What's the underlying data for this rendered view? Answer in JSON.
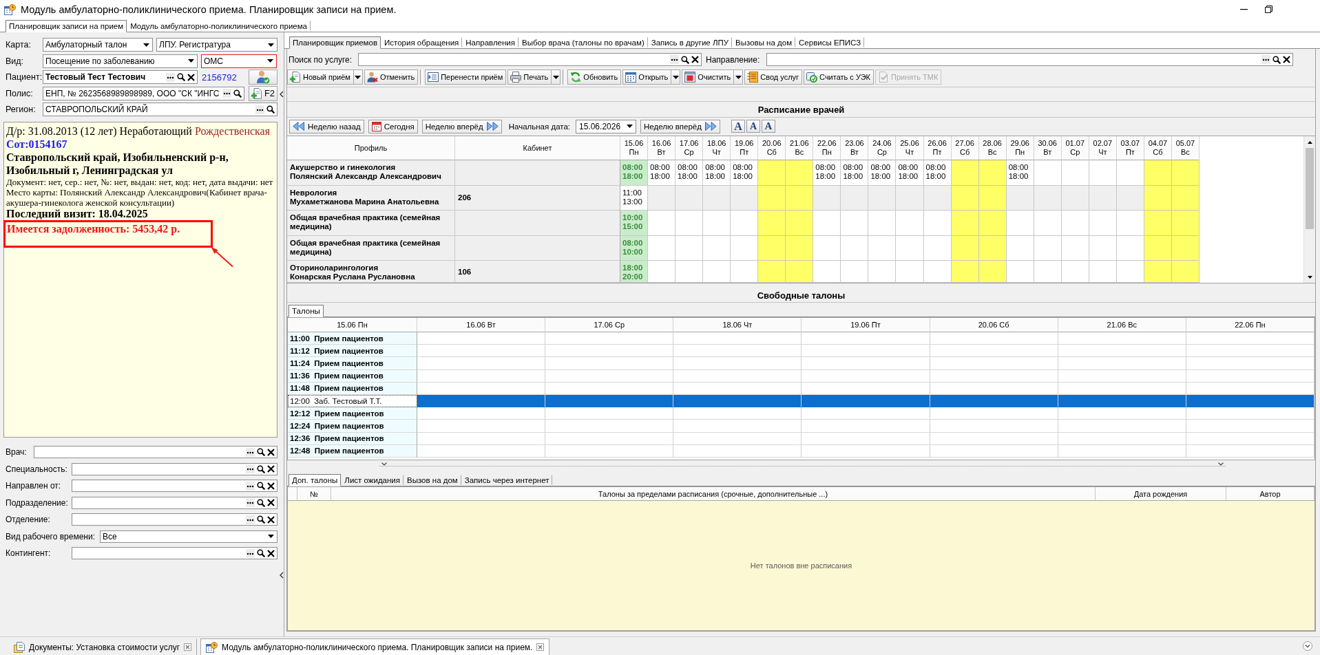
{
  "window": {
    "title": "Модуль амбулаторно-поликлинического приема. Планировщик записи на прием."
  },
  "module_tabs": [
    {
      "label": "Планировщик записи на прием",
      "selected": true
    },
    {
      "label": "Модуль амбулаторно-поликлинического приема",
      "selected": false
    }
  ],
  "patient_form": {
    "card": {
      "label": "Карта:",
      "type": "Амбулаторный талон",
      "registry": "ЛПУ. Регистратура"
    },
    "visit": {
      "label": "Вид:",
      "type": "Посещение по заболеванию",
      "payment": "ОМС",
      "payment_error": true
    },
    "patient": {
      "label": "Пациент:",
      "name": "Тестовый Тест Тестович",
      "number": "2156792"
    },
    "policy": {
      "label": "Полис:",
      "value": "ЕНП, № 2623568989898989, ООО \"СК \"ИНГС",
      "button": "F2"
    },
    "region": {
      "label": "Регион:",
      "value": "СТАВРОПОЛЬСКИЙ КРАЙ"
    }
  },
  "info": {
    "birth": "Д/р: 31.08.2013 (12 лет) Неработающий",
    "surname": "Рождественская",
    "code": "Сот:0154167",
    "address": "Ставропольский край, Изобильненский р-н, Изобильный г, Ленинградская ул",
    "document": "Документ: нет, сер.: нет, №: нет, выдан: нет, код: нет, дата выдачи: нет",
    "card_place": "Место карты: Полянский Александр Александрович(Кабинет врача-акушера-гинеколога женской консультации)",
    "last_visit": "Последний визит: 18.04.2025",
    "debt": "Имеется задолженность: 5453,42 р.",
    "debt_marked": true
  },
  "filters": [
    {
      "label": "Врач:",
      "kind": "primary"
    },
    {
      "label": "Специальность:",
      "kind": "lookup"
    },
    {
      "label": "Направлен от:",
      "kind": "lookup"
    },
    {
      "label": "Подразделение:",
      "kind": "lookup"
    },
    {
      "label": "Отделение:",
      "kind": "lookup"
    },
    {
      "label": "Вид рабочего времени:",
      "kind": "select",
      "value": "Все"
    },
    {
      "label": "Контингент:",
      "kind": "lookup"
    }
  ],
  "tabs": [
    {
      "label": "Планировщик приемов",
      "selected": true
    },
    {
      "label": "История обращения",
      "selected": false
    },
    {
      "label": "Направления",
      "selected": false
    },
    {
      "label": "Выбор врача (талоны по врачам)",
      "selected": false
    },
    {
      "label": "Запись в другие ЛПУ",
      "selected": false
    },
    {
      "label": "Вызовы на дом",
      "selected": false
    },
    {
      "label": "Сервисы ЕПИСЗ",
      "selected": false
    }
  ],
  "search": {
    "service_label": "Поиск по услуге:",
    "direction_label": "Направление:"
  },
  "toolbar": [
    {
      "buttons": [
        {
          "label": "Новый приём",
          "dropdown": true,
          "disabled": false
        },
        {
          "label": "Отменить",
          "dropdown": false,
          "disabled": false
        }
      ]
    },
    {
      "buttons": [
        {
          "label": "Перенести приём",
          "dropdown": false,
          "disabled": false
        },
        {
          "label": "Печать",
          "dropdown": true,
          "disabled": false
        }
      ]
    },
    {
      "buttons": [
        {
          "label": "Обновить",
          "dropdown": false,
          "disabled": false
        },
        {
          "label": "Открыть",
          "dropdown": true,
          "disabled": false
        },
        {
          "label": "Очистить",
          "dropdown": true,
          "disabled": false
        },
        {
          "label": "Свод услуг",
          "dropdown": false,
          "disabled": false
        },
        {
          "label": "Считать с УЭК",
          "dropdown": false,
          "disabled": false
        },
        {
          "label": "Принять ТМК",
          "dropdown": false,
          "disabled": true
        }
      ]
    }
  ],
  "schedule": {
    "title": "Расписание врачей",
    "nav": {
      "back": "Неделю назад",
      "today": "Сегодня",
      "forward": "Неделю вперёд",
      "date_label": "Начальная дата:",
      "date": "15.06.2026",
      "forward_again": "Неделю вперёд",
      "font_buttons": [
        "A",
        "A",
        "A"
      ]
    },
    "profile_header": "Профиль",
    "cabinet_header": "Кабинет",
    "days": [
      {
        "date": "15.06",
        "weekday": "Пн"
      },
      {
        "date": "16.06",
        "weekday": "Вт"
      },
      {
        "date": "17.06",
        "weekday": "Ср"
      },
      {
        "date": "18.06",
        "weekday": "Чт"
      },
      {
        "date": "19.06",
        "weekday": "Пт"
      },
      {
        "date": "20.06",
        "weekday": "Сб"
      },
      {
        "date": "21.06",
        "weekday": "Вс"
      },
      {
        "date": "22.06",
        "weekday": "Пн"
      },
      {
        "date": "23.06",
        "weekday": "Вт"
      },
      {
        "date": "24.06",
        "weekday": "Ср"
      },
      {
        "date": "25.06",
        "weekday": "Чт"
      },
      {
        "date": "26.06",
        "weekday": "Пт"
      },
      {
        "date": "27.06",
        "weekday": "Сб"
      },
      {
        "date": "28.06",
        "weekday": "Вс"
      },
      {
        "date": "29.06",
        "weekday": "Пн"
      },
      {
        "date": "30.06",
        "weekday": "Вт"
      },
      {
        "date": "01.07",
        "weekday": "Ср"
      },
      {
        "date": "02.07",
        "weekday": "Чт"
      },
      {
        "date": "03.07",
        "weekday": "Пт"
      },
      {
        "date": "04.07",
        "weekday": "Сб"
      },
      {
        "date": "05.07",
        "weekday": "Вс"
      }
    ],
    "rows": [
      {
        "profile": "Акушерство и гинекология",
        "doctor": "Полянский Александр Александрович",
        "cells": [
          {
            "kind": "current",
            "start": "08:00",
            "end": "18:00"
          },
          {
            "kind": "work",
            "start": "08:00",
            "end": "18:00"
          },
          {
            "kind": "work",
            "start": "08:00",
            "end": "18:00"
          },
          {
            "kind": "work",
            "start": "08:00",
            "end": "18:00"
          },
          {
            "kind": "work",
            "start": "08:00",
            "end": "18:00"
          },
          {
            "kind": "weekend"
          },
          {
            "kind": "weekend"
          },
          {
            "kind": "work",
            "start": "08:00",
            "end": "18:00"
          },
          {
            "kind": "work",
            "start": "08:00",
            "end": "18:00"
          },
          {
            "kind": "work",
            "start": "08:00",
            "end": "18:00"
          },
          {
            "kind": "work",
            "start": "08:00",
            "end": "18:00"
          },
          {
            "kind": "work",
            "start": "08:00",
            "end": "18:00"
          },
          {
            "kind": "weekend"
          },
          {
            "kind": "weekend"
          },
          {
            "kind": "work",
            "start": "08:00",
            "end": "18:00"
          },
          {
            "kind": "none"
          },
          {
            "kind": "none"
          },
          {
            "kind": "none"
          },
          {
            "kind": "none"
          },
          {
            "kind": "weekend"
          },
          {
            "kind": "weekend"
          }
        ]
      },
      {
        "profile": "Неврология",
        "doctor": "Мухаметжанова Марина Анатольевна",
        "cabinet": "206",
        "cells": [
          {
            "kind": "work",
            "start": "11:00",
            "end": "13:00"
          },
          {
            "kind": "off"
          },
          {
            "kind": "off"
          },
          {
            "kind": "off"
          },
          {
            "kind": "off"
          },
          {
            "kind": "weekend"
          },
          {
            "kind": "weekend"
          },
          {
            "kind": "off"
          },
          {
            "kind": "off"
          },
          {
            "kind": "off"
          },
          {
            "kind": "off"
          },
          {
            "kind": "off"
          },
          {
            "kind": "weekend"
          },
          {
            "kind": "weekend"
          },
          {
            "kind": "off"
          },
          {
            "kind": "off"
          },
          {
            "kind": "off"
          },
          {
            "kind": "off"
          },
          {
            "kind": "off"
          },
          {
            "kind": "weekend"
          },
          {
            "kind": "weekend"
          }
        ]
      },
      {
        "profile": "Общая врачебная практика (семейная медицина)",
        "cells": [
          {
            "kind": "current",
            "start": "10:00",
            "end": "15:00"
          },
          {
            "kind": "none"
          },
          {
            "kind": "none"
          },
          {
            "kind": "none"
          },
          {
            "kind": "none"
          },
          {
            "kind": "weekend"
          },
          {
            "kind": "weekend"
          },
          {
            "kind": "none"
          },
          {
            "kind": "none"
          },
          {
            "kind": "none"
          },
          {
            "kind": "none"
          },
          {
            "kind": "none"
          },
          {
            "kind": "weekend"
          },
          {
            "kind": "weekend"
          },
          {
            "kind": "none"
          },
          {
            "kind": "none"
          },
          {
            "kind": "none"
          },
          {
            "kind": "none"
          },
          {
            "kind": "none"
          },
          {
            "kind": "weekend"
          },
          {
            "kind": "weekend"
          }
        ]
      },
      {
        "profile": "Общая врачебная практика (семейная медицина)",
        "cells": [
          {
            "kind": "current",
            "start": "08:00",
            "end": "10:00"
          },
          {
            "kind": "none"
          },
          {
            "kind": "none"
          },
          {
            "kind": "none"
          },
          {
            "kind": "none"
          },
          {
            "kind": "weekend"
          },
          {
            "kind": "weekend"
          },
          {
            "kind": "none"
          },
          {
            "kind": "none"
          },
          {
            "kind": "none"
          },
          {
            "kind": "none"
          },
          {
            "kind": "none"
          },
          {
            "kind": "weekend"
          },
          {
            "kind": "weekend"
          },
          {
            "kind": "none"
          },
          {
            "kind": "none"
          },
          {
            "kind": "none"
          },
          {
            "kind": "none"
          },
          {
            "kind": "none"
          },
          {
            "kind": "weekend"
          },
          {
            "kind": "weekend"
          }
        ]
      },
      {
        "profile": "Оториноларингология",
        "doctor": "Конарская Руслана Руслановна",
        "cabinet": "106",
        "cells": [
          {
            "kind": "current",
            "start": "18:00",
            "end": "20:00"
          },
          {
            "kind": "none"
          },
          {
            "kind": "none"
          },
          {
            "kind": "none"
          },
          {
            "kind": "none"
          },
          {
            "kind": "weekend"
          },
          {
            "kind": "weekend"
          },
          {
            "kind": "none"
          },
          {
            "kind": "none"
          },
          {
            "kind": "none"
          },
          {
            "kind": "none"
          },
          {
            "kind": "none"
          },
          {
            "kind": "weekend"
          },
          {
            "kind": "weekend"
          },
          {
            "kind": "none"
          },
          {
            "kind": "none"
          },
          {
            "kind": "none"
          },
          {
            "kind": "none"
          },
          {
            "kind": "none"
          },
          {
            "kind": "weekend"
          },
          {
            "kind": "weekend"
          }
        ]
      }
    ]
  },
  "talons": {
    "title": "Свободные талоны",
    "tab": {
      "label": "Талоны",
      "selected": true
    },
    "days": [
      "15.06 Пн",
      "16.06 Вт",
      "17.06 Ср",
      "18.06 Чт",
      "19.06 Пт",
      "20.06 Сб",
      "21.06 Вс",
      "22.06 Пн"
    ],
    "rows": [
      {
        "text": "11:00  Прием пациентов",
        "booked": false,
        "selected": false
      },
      {
        "text": "11:12  Прием пациентов",
        "booked": false,
        "selected": false
      },
      {
        "text": "11:24  Прием пациентов",
        "booked": false,
        "selected": false
      },
      {
        "text": "11:36  Прием пациентов",
        "booked": false,
        "selected": false
      },
      {
        "text": "11:48  Прием пациентов",
        "booked": false,
        "selected": false
      },
      {
        "text": "12:00  Заб. Тестовый Т.Т.",
        "booked": true,
        "selected": true
      },
      {
        "text": "12:12  Прием пациентов",
        "booked": false,
        "selected": false
      },
      {
        "text": "12:24  Прием пациентов",
        "booked": false,
        "selected": false
      },
      {
        "text": "12:36  Прием пациентов",
        "booked": false,
        "selected": false
      },
      {
        "text": "12:48  Прием пациентов",
        "booked": false,
        "selected": false
      }
    ]
  },
  "extra": {
    "tabs": [
      {
        "label": "Доп. талоны",
        "selected": true
      },
      {
        "label": "Лист ожидания",
        "selected": false
      },
      {
        "label": "Вызов на дом",
        "selected": false
      },
      {
        "label": "Запись через интернет",
        "selected": false
      }
    ],
    "columns": [
      "№",
      "Талоны за пределами расписания (срочные, дополнительные ...)",
      "Дата рождения",
      "Автор"
    ],
    "empty_message": "Нет талонов вне расписания"
  },
  "documents": [
    {
      "title": "Документы: Установка стоимости услуг",
      "selected": false
    },
    {
      "title": "Модуль амбулаторно-поликлинического приема. Планировщик записи на прием.",
      "selected": true
    }
  ]
}
